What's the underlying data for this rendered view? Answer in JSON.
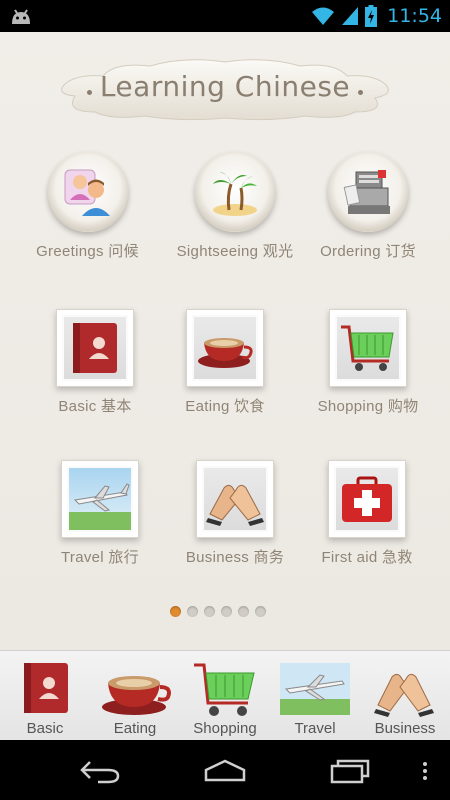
{
  "status_bar": {
    "time": "11:54"
  },
  "header": {
    "title": "Learning Chinese"
  },
  "categories_round": [
    {
      "label": "Greetings  问候",
      "icon": "people-icon"
    },
    {
      "label": "Sightseeing  观光",
      "icon": "palm-island-icon"
    },
    {
      "label": "Ordering  订货",
      "icon": "cash-register-icon"
    }
  ],
  "categories_square": [
    {
      "label": "Basic  基本",
      "icon": "contact-book-icon"
    },
    {
      "label": "Eating  饮食",
      "icon": "coffee-cup-icon"
    },
    {
      "label": "Shopping  购物",
      "icon": "shopping-cart-icon"
    },
    {
      "label": "Travel  旅行",
      "icon": "airplane-icon"
    },
    {
      "label": "Business  商务",
      "icon": "handshake-icon"
    },
    {
      "label": "First aid  急救",
      "icon": "first-aid-kit-icon"
    }
  ],
  "pager": {
    "count": 6,
    "active_index": 0
  },
  "tab_bar": [
    {
      "label": "Basic"
    },
    {
      "label": "Eating"
    },
    {
      "label": "Shopping"
    },
    {
      "label": "Travel"
    },
    {
      "label": "Business"
    }
  ],
  "colors": {
    "accent": "#e08b2e",
    "status_time": "#33b5e5",
    "label_text": "#8f8576"
  }
}
